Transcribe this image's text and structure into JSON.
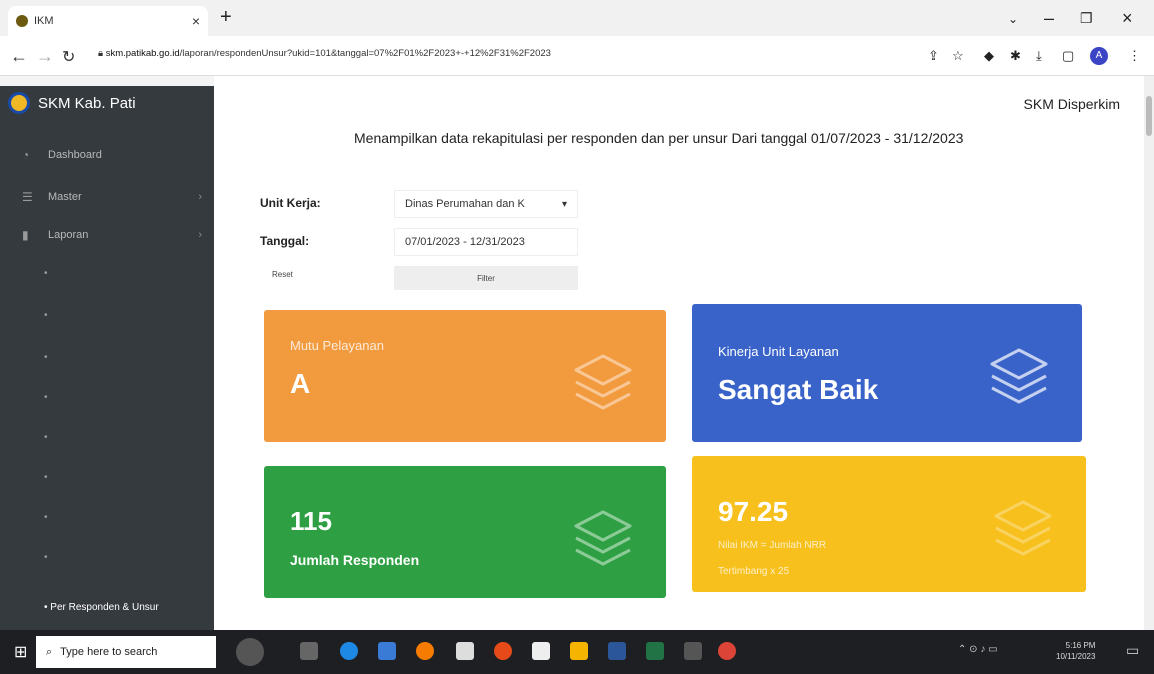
{
  "browser": {
    "tab_title": "IKM",
    "url_host": "skm.patikab.go.id",
    "url_path": "/laporan/respondenUnsur?ukid=101&tanggal=07%2F01%2F2023+-+12%2F31%2F2023",
    "avatar_letter": "A"
  },
  "sidebar": {
    "brand": "SKM Kab. Pati",
    "items": [
      {
        "label": "Dashboard",
        "icon": "dashboard-icon"
      },
      {
        "label": "Master",
        "icon": "list-icon"
      },
      {
        "label": "Laporan",
        "icon": "document-icon"
      }
    ],
    "active_sub": "Per Responden & Unsur"
  },
  "header": {
    "right_title": "SKM Disperkim",
    "headline": "Menampilkan data rekapitulasi per responden dan per unsur Dari tanggal 01/07/2023 - 31/12/2023"
  },
  "filters": {
    "unit_label": "Unit Kerja:",
    "unit_value": "Dinas Perumahan dan K",
    "date_label": "Tanggal:",
    "date_value": "07/01/2023 - 12/31/2023",
    "reset_label": "Reset",
    "filter_label": "Filter"
  },
  "cards": {
    "mutu": {
      "label": "Mutu Pelayanan",
      "value": "A",
      "color": "#f29a3e"
    },
    "kinerja": {
      "label": "Kinerja Unit Layanan",
      "value": "Sangat Baik",
      "color": "#3a63c9"
    },
    "responden": {
      "value": "115",
      "label": "Jumlah Responden",
      "color": "#2ea043"
    },
    "ikm": {
      "value": "97.25",
      "note_line1": "Nilai IKM = Jumlah NRR",
      "note_line2": "Tertimbang x 25",
      "color": "#f7c01c"
    }
  },
  "taskbar": {
    "search_placeholder": "Type here to search",
    "time": "5:16 PM",
    "date": "10/11/2023"
  }
}
